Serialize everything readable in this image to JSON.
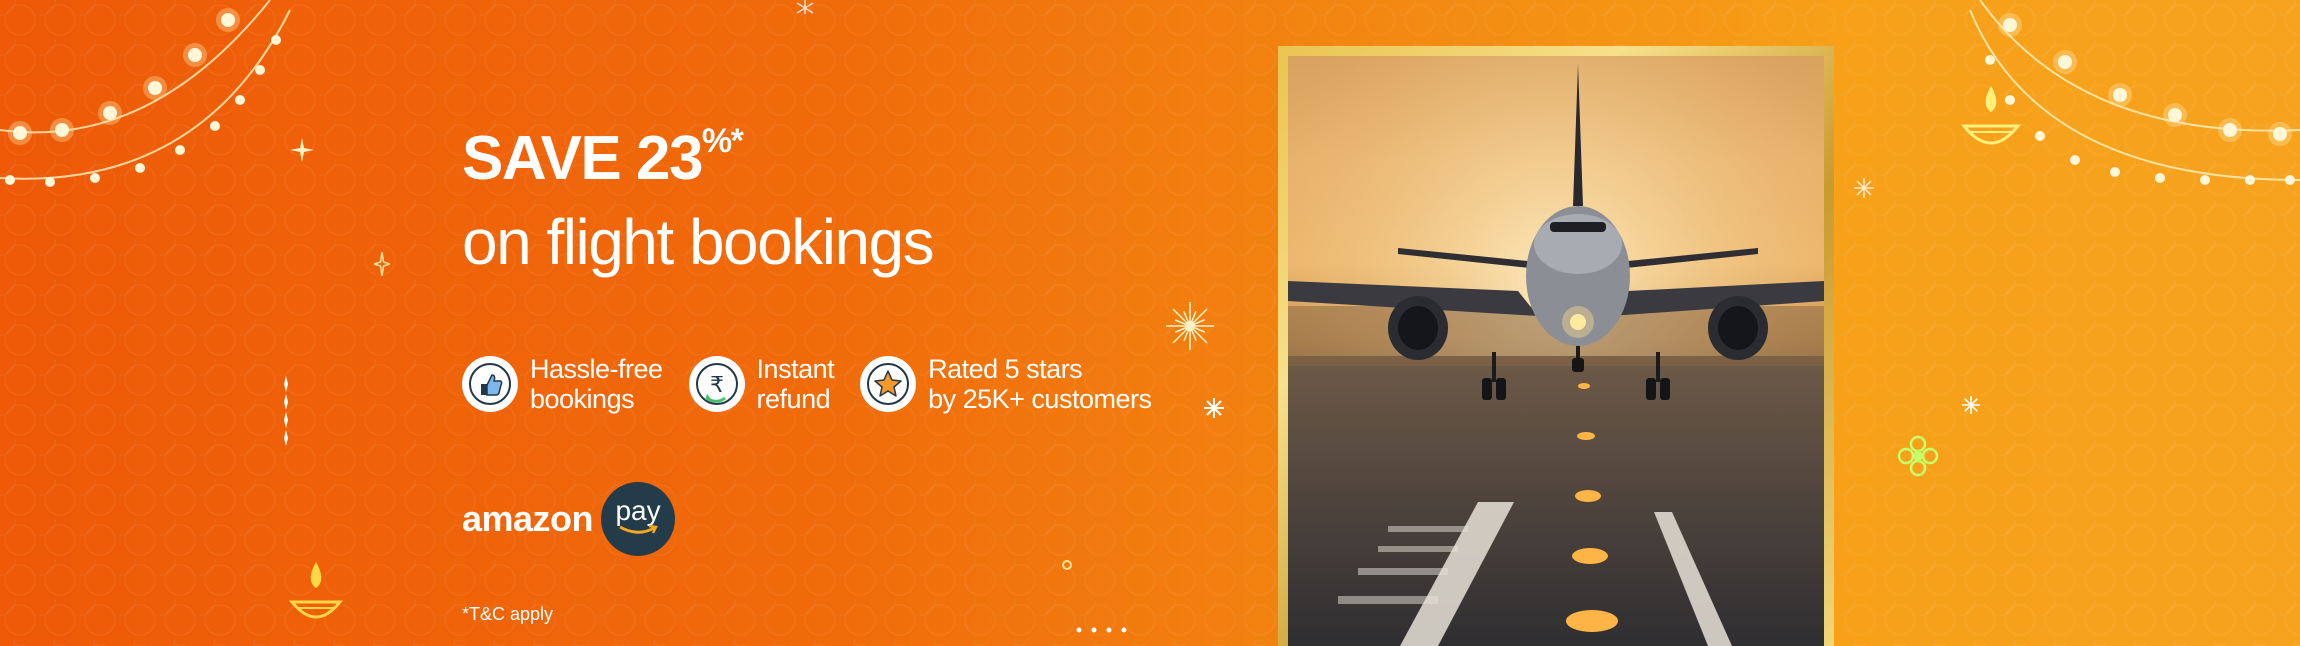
{
  "promo": {
    "save_text": "SAVE 23",
    "save_suffix": "%*",
    "subtitle": "on flight bookings"
  },
  "features": [
    {
      "icon": "thumbs-up-icon",
      "line1": "Hassle-free",
      "line2": "bookings"
    },
    {
      "icon": "rupee-refund-icon",
      "line1": "Instant",
      "line2": "refund"
    },
    {
      "icon": "star-badge-icon",
      "line1": "Rated 5 stars",
      "line2": "by 25K+ customers"
    }
  ],
  "brand": {
    "word": "amazon",
    "pill": "pay"
  },
  "tnc": "*T&C apply",
  "colors": {
    "bg_left": "#ee5a08",
    "bg_right": "#f7a320",
    "pay_pill": "#243b4a",
    "frame_gold": "#e9c450"
  }
}
